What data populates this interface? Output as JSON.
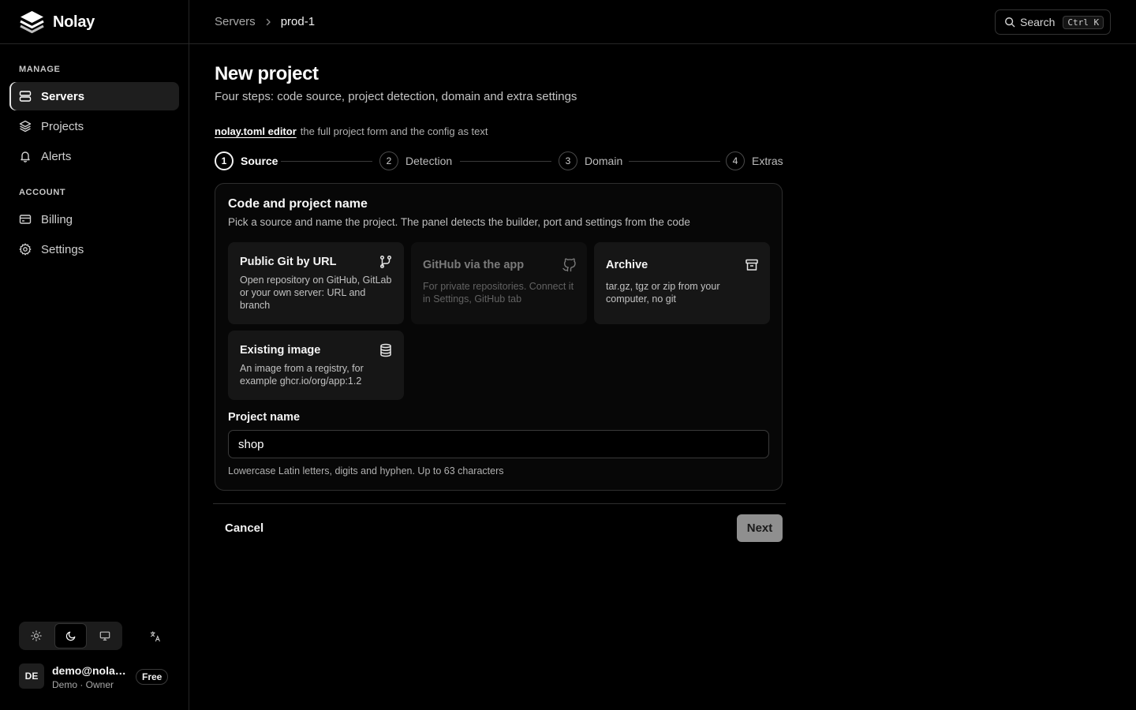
{
  "app": {
    "name": "Nolay"
  },
  "sidebar": {
    "manage_label": "MANAGE",
    "account_label": "ACCOUNT",
    "manage_items": [
      {
        "label": "Servers",
        "icon": "server-icon",
        "active": true
      },
      {
        "label": "Projects",
        "icon": "layers-icon",
        "active": false
      },
      {
        "label": "Alerts",
        "icon": "bell-icon",
        "active": false
      }
    ],
    "account_items": [
      {
        "label": "Billing",
        "icon": "credit-card-icon",
        "active": false
      },
      {
        "label": "Settings",
        "icon": "gear-icon",
        "active": false
      }
    ],
    "theme": {
      "options": [
        "light",
        "dark",
        "system"
      ],
      "selected": "dark"
    },
    "language_icon": "translate-icon",
    "user": {
      "initials": "DE",
      "email": "demo@nolay...",
      "role": "Demo · Owner",
      "plan": "Free"
    }
  },
  "topbar": {
    "breadcrumb": [
      "Servers",
      "prod-1"
    ],
    "search": {
      "label": "Search",
      "shortcut": "Ctrl K"
    }
  },
  "page": {
    "title": "New project",
    "subtitle": "Four steps: code source, project detection, domain and extra settings",
    "editor_link": "nolay.toml editor",
    "editor_desc": "the full project form and the config as text"
  },
  "stepper": {
    "current": 1,
    "steps": [
      {
        "num": "1",
        "label": "Source"
      },
      {
        "num": "2",
        "label": "Detection"
      },
      {
        "num": "3",
        "label": "Domain"
      },
      {
        "num": "4",
        "label": "Extras"
      }
    ]
  },
  "source_card": {
    "title": "Code and project name",
    "description": "Pick a source and name the project. The panel detects the builder, port and settings from the code",
    "options": [
      {
        "title": "Public Git by URL",
        "desc": "Open repository on GitHub, GitLab or your own server: URL and branch",
        "icon": "git-branch-icon",
        "disabled": false
      },
      {
        "title": "GitHub via the app",
        "desc": "For private repositories. Connect it in Settings, GitHub tab",
        "icon": "github-icon",
        "disabled": true
      },
      {
        "title": "Archive",
        "desc": "tar.gz, tgz or zip from your computer, no git",
        "icon": "archive-icon",
        "disabled": false
      },
      {
        "title": "Existing image",
        "desc": "An image from a registry, for example ghcr.io/org/app:1.2",
        "icon": "database-icon",
        "disabled": false
      }
    ],
    "project_name": {
      "label": "Project name",
      "value": "shop",
      "hint": "Lowercase Latin letters, digits and hyphen. Up to 63 characters"
    }
  },
  "actions": {
    "cancel": "Cancel",
    "next": "Next"
  },
  "colors": {
    "background": "#000000",
    "surface": "#161616",
    "border": "#2e2e2e",
    "next_button": "#8f8f8f"
  }
}
